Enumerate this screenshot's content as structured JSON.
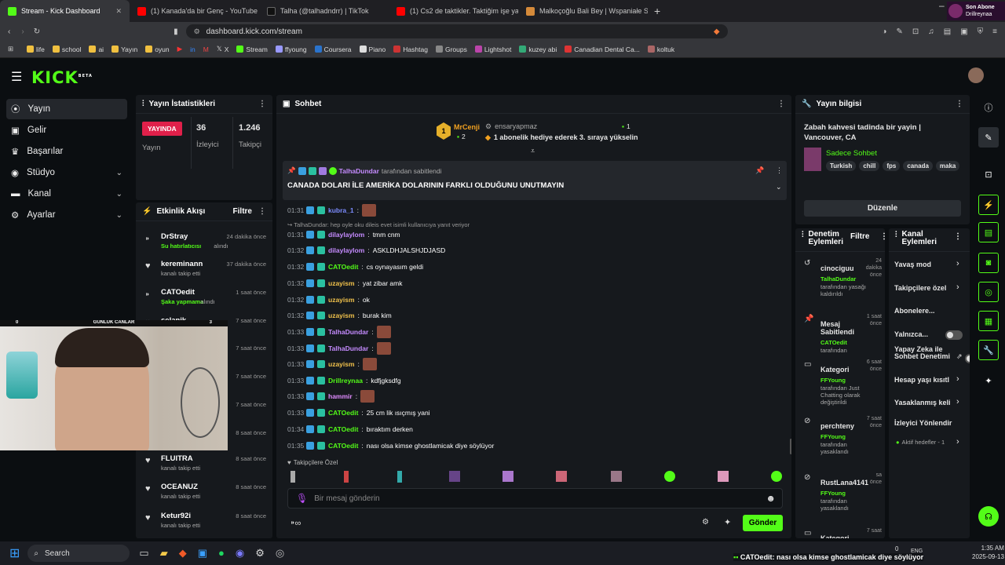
{
  "browser": {
    "tabs": [
      {
        "label": "Stream - Kick Dashboard",
        "color": "#53fc18"
      },
      {
        "label": "(1) Kanada'da bir Genç - YouTube",
        "color": "#ff0000"
      },
      {
        "label": "Talha (@talhadndrr) | TikTok",
        "color": "#111111"
      },
      {
        "label": "(1) Cs2 de taktikler. Taktiğim işe yara",
        "color": "#ff0000"
      },
      {
        "label": "Malkoçoğlu Bali Bey | Wspaniałe Stul",
        "color": "#d58a3a"
      }
    ],
    "new_tab": "+",
    "url": "dashboard.kick.com/stream",
    "notif_title": "Son Abone",
    "notif_sub": "Drillreynaa",
    "bookmarks": [
      "life",
      "school",
      "ai",
      "Yayın",
      "oyun",
      "X",
      "Stream",
      "ffyoung",
      "Coursera",
      "Piano",
      "Hashtag",
      "Groups",
      "Lightshot",
      "kuzey abi",
      "Canadian Dental Ca...",
      "koltuk"
    ]
  },
  "app": {
    "logo": "KICK",
    "logo_sup": "BETA"
  },
  "sidebar": {
    "items": [
      {
        "label": "Yayın",
        "icon": "broadcast-icon"
      },
      {
        "label": "Gelir",
        "icon": "money-icon"
      },
      {
        "label": "Başarılar",
        "icon": "trophy-icon"
      },
      {
        "label": "Stüdyo",
        "icon": "studio-icon",
        "chevron": true
      },
      {
        "label": "Kanal",
        "icon": "channel-icon",
        "chevron": true
      },
      {
        "label": "Ayarlar",
        "icon": "gear-icon",
        "chevron": true
      }
    ]
  },
  "stats": {
    "title": "Yayın İstatistikleri",
    "live": "YAYINDA",
    "live_label": "Yayın",
    "viewers": "36",
    "viewers_label": "İzleyici",
    "followers": "1.246",
    "followers_label": "Takipçi"
  },
  "activity": {
    "title": "Etkinlik Akışı",
    "filter": "Filtre",
    "items": [
      {
        "name": "DrStray",
        "time": "24 dakika önce",
        "desc": "Su hatırlatıcısı",
        "desc2": " alındı",
        "green": true
      },
      {
        "name": "kereminann",
        "time": "37 dakika önce",
        "desc": "kanalı takip etti",
        "green": false
      },
      {
        "name": "CATOedit",
        "time": "1 saat önce",
        "desc": "Şaka yapmama",
        "desc2": " alındı",
        "green": true
      },
      {
        "name": "selanik",
        "time": "7 saat önce",
        "desc": "",
        "green": false
      },
      {
        "name": "",
        "time": "7 saat önce",
        "desc": "",
        "green": false
      },
      {
        "name": "",
        "time": "7 saat önce",
        "desc": "",
        "green": false
      },
      {
        "name": "",
        "time": "7 saat önce",
        "desc": "",
        "green": false
      },
      {
        "name": "",
        "time": "8 saat önce",
        "desc": "",
        "green": false
      },
      {
        "name": "FLUITRA",
        "time": "8 saat önce",
        "desc": "kanalı takip etti",
        "green": false
      },
      {
        "name": "OCEANUZ",
        "time": "8 saat önce",
        "desc": "kanalı takip etti",
        "green": false
      },
      {
        "name": "Ketur92i",
        "time": "8 saat önce",
        "desc": "kanalı takip etti",
        "green": false
      }
    ]
  },
  "cam_overlay": {
    "left": "0",
    "title": "GÜNLÜK CANLAR",
    "right": "3"
  },
  "chat": {
    "title": "Sohbet",
    "top_user": "MrCenji",
    "top_rank": "1",
    "top_count": "2",
    "gift_user": "ensaryapmaz",
    "gift_count": "1",
    "gift_text": "1 abonelik hediye ederek 3. sıraya yükselin",
    "pinned_by": "TalhaDundar",
    "pinned_suffix": "tarafından sabitlendi",
    "pinned_msg": "CANADA DOLARI İLE AMERİKA DOLARININ FARKLI OLDUĞUNU UNUTMAYIN",
    "reply_note": "TalhaDundar: hep oyle oku dileis evet isimli kullanıcıya yanıt veriyor",
    "lines": [
      {
        "t": "01:31",
        "user": "kubra_1",
        "color": "#7c8cff",
        "msg": "",
        "emote": true
      },
      {
        "t": "01:31",
        "user": "dilaylaylom",
        "color": "#c58bff",
        "msg": "tmm cnm"
      },
      {
        "t": "01:32",
        "user": "dilaylaylom",
        "color": "#c58bff",
        "msg": "ASKLDHJALSHJDJASD"
      },
      {
        "t": "01:32",
        "user": "CATOedit",
        "color": "#53fc18",
        "msg": "cs oynayasım geldi"
      },
      {
        "t": "01:32",
        "user": "uzayism",
        "color": "#f0c14b",
        "msg": "yat zibar amk"
      },
      {
        "t": "01:32",
        "user": "uzayism",
        "color": "#f0c14b",
        "msg": "ok"
      },
      {
        "t": "01:32",
        "user": "uzayism",
        "color": "#f0c14b",
        "msg": "burak kim"
      },
      {
        "t": "01:33",
        "user": "TalhaDundar",
        "color": "#c58bff",
        "msg": "",
        "emote": true
      },
      {
        "t": "01:33",
        "user": "TalhaDundar",
        "color": "#c58bff",
        "msg": "",
        "emote": true
      },
      {
        "t": "01:33",
        "user": "uzayism",
        "color": "#f0c14b",
        "msg": "",
        "emote": true
      },
      {
        "t": "01:33",
        "user": "Drillreynaa",
        "color": "#53fc18",
        "msg": "kdfjgksdfg"
      },
      {
        "t": "01:33",
        "user": "hammir",
        "color": "#e08bff",
        "msg": "",
        "emote": true
      },
      {
        "t": "01:33",
        "user": "CATOedit",
        "color": "#53fc18",
        "msg": "25 cm lik ısıçmış yani"
      },
      {
        "t": "01:34",
        "user": "CATOedit",
        "color": "#53fc18",
        "msg": "bıraktım derken"
      },
      {
        "t": "01:35",
        "user": "CATOedit",
        "color": "#53fc18",
        "msg": "nası olsa kimse ghostlamicak diye söylüyor"
      }
    ],
    "followers_only": "Takipçilere Özel",
    "input_placeholder": "Bir mesaj gönderin",
    "send": "Gönder"
  },
  "stream_info": {
    "title": "Yayın bilgisi",
    "stream_title": "Zabah kahvesi tadinda bir yayin | Vancouver, CA",
    "category": "Sadece Sohbet",
    "tags": [
      "Turkish",
      "chill",
      "fps",
      "canada",
      "maka"
    ],
    "edit": "Düzenle"
  },
  "mod": {
    "title": "Denetim Eylemleri",
    "filter": "Filtre",
    "items": [
      {
        "name": "cinociguu",
        "time": "24 dakika önce",
        "by": "TalhaDundar",
        "desc": "tarafından yasağı kaldırıldı",
        "icon": "undo-icon"
      },
      {
        "name": "Mesaj Sabitlendi",
        "time": "1 saat önce",
        "by": "CATOedit",
        "desc": "tarafından",
        "icon": "pin-icon"
      },
      {
        "name": "Kategori",
        "time": "6 saat önce",
        "by": "FFYoung",
        "desc": "tarafından Just Chatting olarak değiştirildi",
        "icon": "category-icon"
      },
      {
        "name": "perchteny",
        "time": "7 saat önce",
        "by": "FFYoung",
        "desc": "tarafından yasaklandı",
        "icon": "ban-icon"
      },
      {
        "name": "RustLana4141",
        "time": "sa önce",
        "by": "FFYoung",
        "desc": "tarafından yasaklandı",
        "icon": "ban-icon"
      },
      {
        "name": "Kategori",
        "time": "7 saat",
        "by": "",
        "desc": "",
        "icon": "category-icon"
      }
    ]
  },
  "channel_actions": {
    "title": "Kanal Eylemleri",
    "items": [
      "Yavaş mod",
      "Takipçilere özel",
      "Abonelere...",
      "Yalnızca...",
      "Yapay Zeka ile Sohbet Denetimi",
      "Hesap yaşı kısıtl",
      "Yasaklanmış keli",
      "İzleyici Yönlendir"
    ],
    "active_targets": "Aktif hedefler - 1"
  },
  "taskbar": {
    "search": "Search",
    "ticker_user": "CATOedit",
    "ticker_msg": ": nası olsa kimse ghostlamicak diye söylüyor",
    "lang": "ENG",
    "time": "1:35 AM",
    "date": "2025-09-13",
    "notif_count": "0"
  }
}
